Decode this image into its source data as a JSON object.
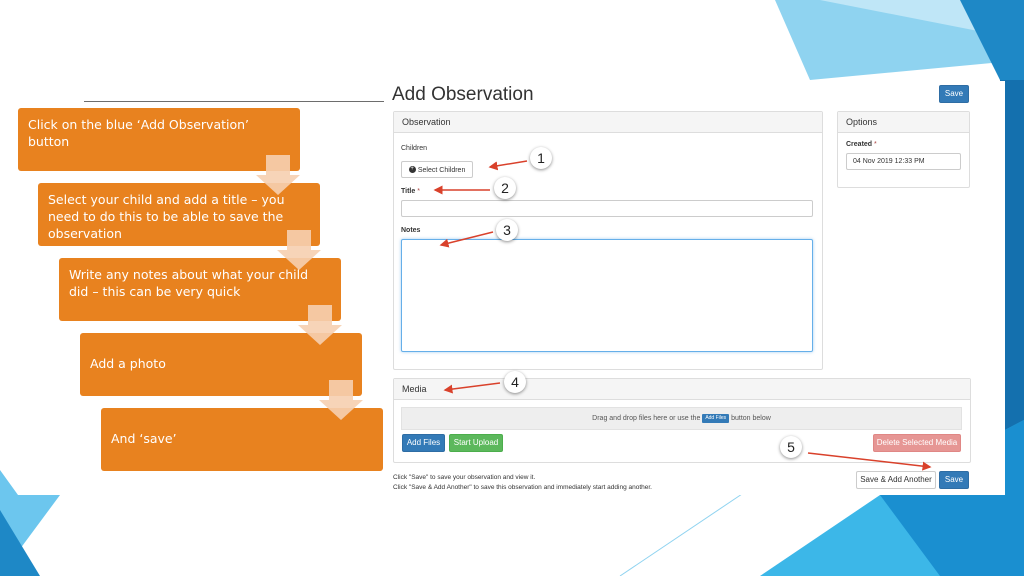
{
  "steps": [
    {
      "text": "Click on the blue ‘Add Observation’ button"
    },
    {
      "text": "Select your child and add a title – you need to do this to be able to save the observation"
    },
    {
      "text": "Write any notes about what your child did – this can be very quick"
    },
    {
      "text": "Add a photo"
    },
    {
      "text": "And ‘save’"
    }
  ],
  "form": {
    "title": "Add Observation",
    "save_top": "Save",
    "observation_panel": {
      "heading": "Observation",
      "children_label": "Children",
      "select_children": "Select Children",
      "title_label": "Title",
      "required_mark": "*",
      "notes_label": "Notes",
      "title_value": "",
      "notes_value": ""
    },
    "options_panel": {
      "heading": "Options",
      "created_label": "Created",
      "created_value": "04 Nov 2019 12:33 PM"
    },
    "media_panel": {
      "heading": "Media",
      "drop_prefix": "Drag and drop files here or use the",
      "drop_button": "Add Files",
      "drop_suffix": "button below",
      "add_files": "Add Files",
      "start_upload": "Start Upload",
      "delete_selected": "Delete Selected Media"
    },
    "help_line1": "Click \"Save\" to save your observation and view it.",
    "help_line2": "Click \"Save & Add Another\" to save this observation and immediately start adding another.",
    "save_add_another": "Save & Add Another",
    "save_bottom": "Save"
  },
  "callouts": [
    "1",
    "2",
    "3",
    "4",
    "5"
  ],
  "colors": {
    "step_orange": "#e8821f",
    "primary_blue": "#337ab7",
    "success_green": "#5cb85c",
    "danger_dim": "#e69694",
    "annotation_red": "#d9412b",
    "deco_blue": "#29a9e0"
  },
  "icons": {
    "select_children": "plus-circle-icon",
    "flow_arrow": "down-arrow-icon"
  }
}
